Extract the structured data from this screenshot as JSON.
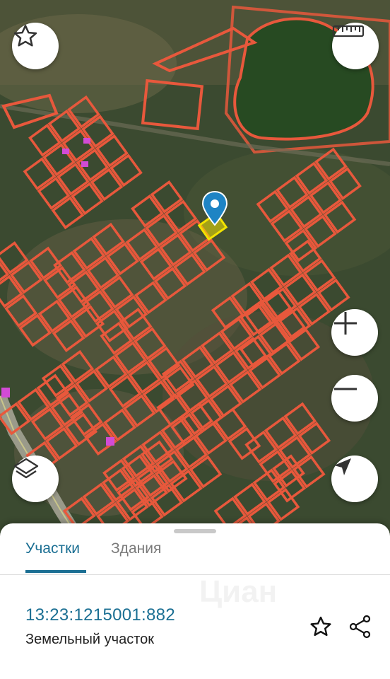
{
  "map": {
    "type": "satellite",
    "parcel_outline_color": "#e8583c",
    "selected_parcel_color": "#f2e300",
    "pin_color": "#1e84c4",
    "water_color": "#274a22",
    "highlight_color": "#d24bd6"
  },
  "controls": {
    "favorite_icon": "star-outline-icon",
    "ruler_icon": "ruler-icon",
    "zoom_in_icon": "plus-icon",
    "zoom_out_icon": "minus-icon",
    "layers_icon": "layers-icon",
    "locate_icon": "navigation-arrow-icon"
  },
  "sheet": {
    "tabs": [
      {
        "label": "Участки",
        "active": true
      },
      {
        "label": "Здания",
        "active": false
      }
    ],
    "parcel": {
      "cadastral_number": "13:23:1215001:882",
      "type": "Земельный участок"
    },
    "watermark": "Циан",
    "actions": {
      "favorite_icon": "star-outline-icon",
      "share_icon": "share-icon"
    }
  }
}
